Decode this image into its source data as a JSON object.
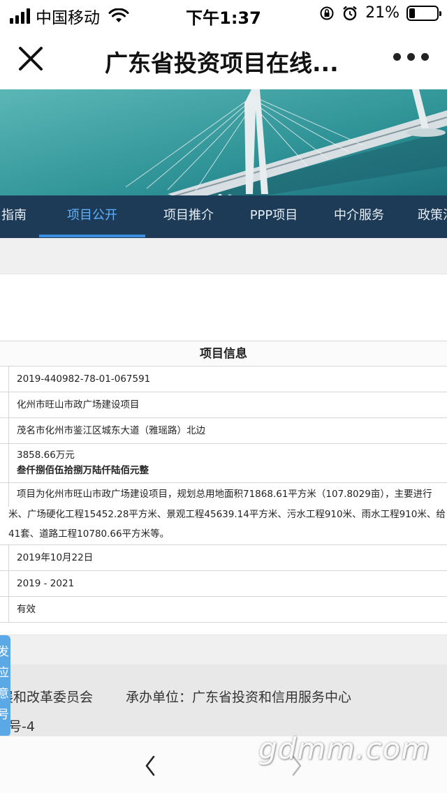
{
  "status_bar": {
    "carrier": "中国移动",
    "time": "下午1:37",
    "battery_percent": "21%",
    "battery_level": 0.21
  },
  "nav": {
    "title": "广东省投资项目在线..."
  },
  "tabs": [
    "指南",
    "项目公开",
    "项目推介",
    "PPP项目",
    "中介服务",
    "政策法"
  ],
  "active_tab": "项目公开",
  "table": {
    "header": "项目信息",
    "rows": {
      "code": "2019-440982-78-01-067591",
      "name": "化州市旺山市政广场建设项目",
      "location": "茂名市化州市鉴江区城东大道（雅瑶路）北边",
      "investment": "3858.66万元",
      "investment_upper": "叁仟捌佰伍拾捌万陆仟陆佰元整",
      "desc_1": "项目为化州市旺山市政广场建设项目，规划总用地面积71868.61平方米（107.8029亩），主要进行",
      "desc_2": "米、广场硬化工程15452.28平方米、景观工程45639.14平方米、污水工程910米、雨水工程910米、给",
      "desc_3": "41套、道路工程10780.66平方米等。",
      "date": "2019年10月22日",
      "period": "2019 - 2021",
      "status": "有效"
    }
  },
  "footer": {
    "sponsor_partial": "展和改革委员会",
    "organizer": "承办单位：广东省投资和信用服务中心",
    "id_partial": "号-4"
  },
  "side_tab_chars": [
    "发",
    "应",
    "意",
    "号"
  ],
  "watermark": "gdmm.com",
  "icons": {
    "close": "close-icon",
    "more": "more-icon",
    "back": "chevron-left-icon",
    "forward": "chevron-right-icon"
  }
}
